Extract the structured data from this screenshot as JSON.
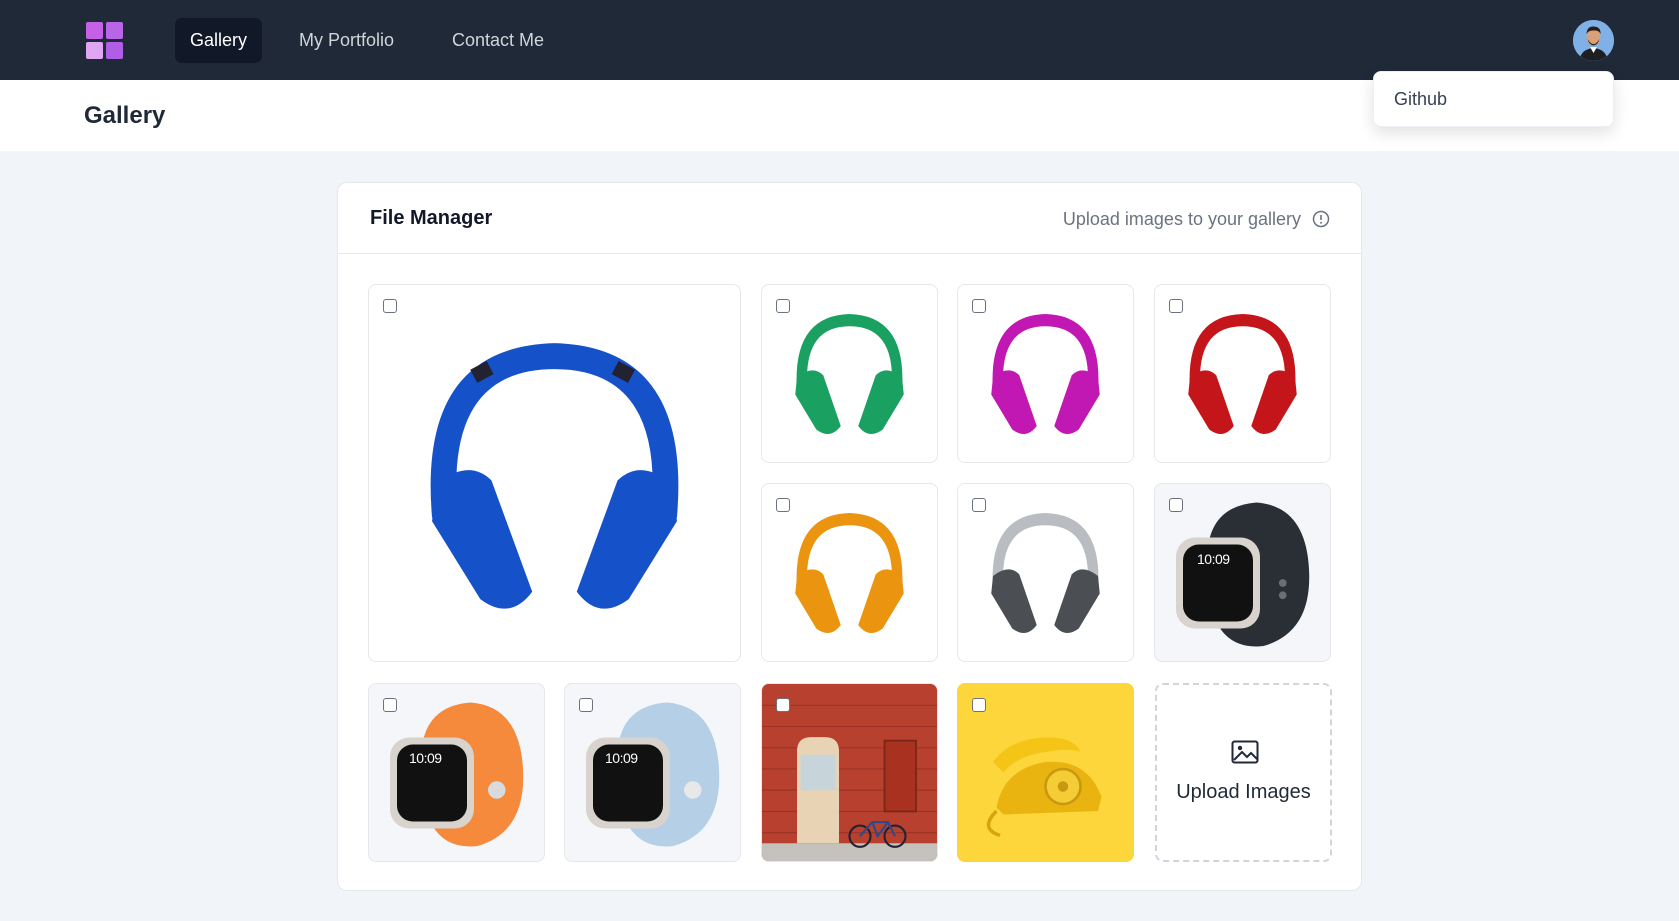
{
  "nav": {
    "items": [
      {
        "label": "Gallery",
        "active": true
      },
      {
        "label": "My Portfolio",
        "active": false
      },
      {
        "label": "Contact Me",
        "active": false
      }
    ],
    "logo_colors": [
      "#c561e7",
      "#b865e8",
      "#e0a6f1",
      "#b15ee6"
    ]
  },
  "dropdown": {
    "items": [
      {
        "label": "Github"
      }
    ]
  },
  "page": {
    "title": "Gallery"
  },
  "file_manager": {
    "title": "File Manager",
    "hint": "Upload images to your gallery",
    "images": [
      {
        "name": "blue-headphones",
        "color": "#1552c9"
      },
      {
        "name": "green-headphones",
        "color": "#1aa060"
      },
      {
        "name": "magenta-headphones",
        "color": "#c117b3"
      },
      {
        "name": "red-headphones",
        "color": "#c4161a"
      },
      {
        "name": "orange-headphones",
        "color": "#ea9410"
      },
      {
        "name": "silver-headphones",
        "color": "#b9bcc0"
      },
      {
        "name": "black-band-watch",
        "color": "#2a2e35"
      },
      {
        "name": "orange-band-watch",
        "color": "#f58a3c"
      },
      {
        "name": "light-blue-band-watch",
        "color": "#b5cfe6"
      },
      {
        "name": "red-brick-wall-bicycle",
        "color": "#b8402e"
      },
      {
        "name": "yellow-telephone",
        "color": "#f2c21a"
      }
    ],
    "watch_time": "10:09",
    "upload_label": "Upload Images"
  }
}
